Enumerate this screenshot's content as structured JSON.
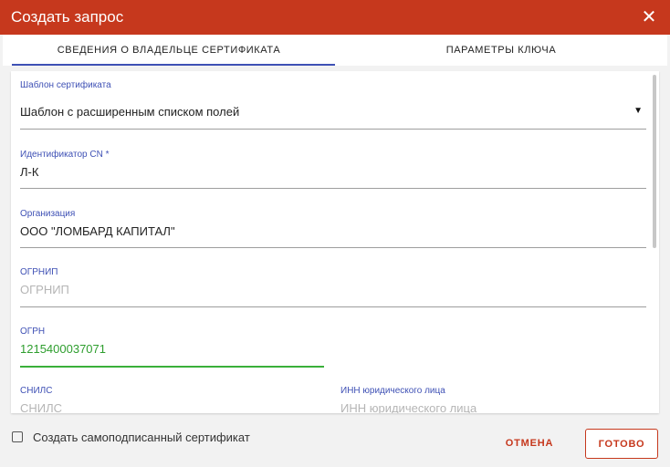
{
  "dialog": {
    "title": "Создать запрос",
    "close_icon": "close-icon"
  },
  "tabs": [
    {
      "label": "СВЕДЕНИЯ О ВЛАДЕЛЬЦЕ СЕРТИФИКАТА",
      "active": true
    },
    {
      "label": "ПАРАМЕТРЫ КЛЮЧА",
      "active": false
    }
  ],
  "form": {
    "template": {
      "label": "Шаблон сертификата",
      "value": "Шаблон с расширенным списком полей"
    },
    "cn": {
      "label": "Идентификатор CN *",
      "value": "Л-К"
    },
    "organization": {
      "label": "Организация",
      "value": "ООО \"ЛОМБАРД КАПИТАЛ\""
    },
    "ogrnip": {
      "label": "ОГРНИП",
      "placeholder": "ОГРНИП"
    },
    "ogrn": {
      "label": "ОГРН",
      "value": "1215400037071"
    },
    "snils": {
      "label": "СНИЛС",
      "placeholder": "СНИЛС"
    },
    "inn_ul": {
      "label": "ИНН юридического лица",
      "placeholder": "ИНН юридического лица"
    }
  },
  "footer": {
    "self_signed_label": "Создать самоподписанный сертификат",
    "cancel_label": "ОТМЕНА",
    "ok_label": "ГОТОВО"
  },
  "colors": {
    "accent": "#c6381d",
    "label": "#3f51b5",
    "focus": "#3ab03a"
  }
}
